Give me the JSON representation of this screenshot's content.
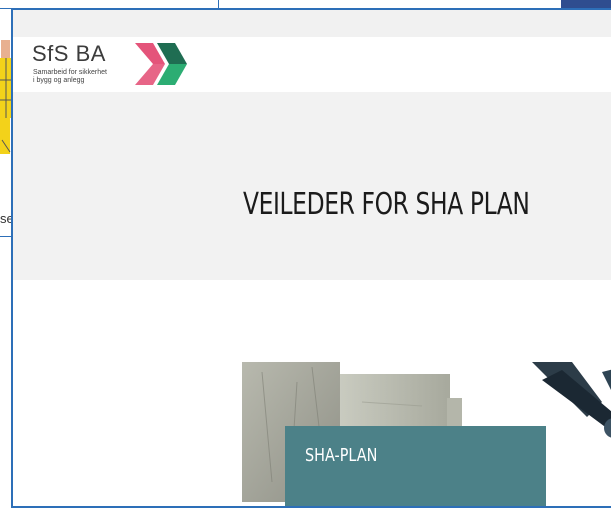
{
  "background": {
    "partial_text": "se"
  },
  "logo": {
    "name": "SfS BA",
    "line1": "Samarbeid for sikkerhet",
    "line2": "i bygg og anlegg",
    "colors": {
      "pink": "#e4547a",
      "green": "#2cad73",
      "dark": "#1f6d52"
    }
  },
  "hero": {
    "title": "VEILEDER FOR SHA PLAN"
  },
  "card": {
    "label": "SHA-PLAN",
    "color": "#4c8188"
  },
  "colors": {
    "frame_border": "#2d6fb8",
    "hero_background": "#f2f2f2"
  }
}
